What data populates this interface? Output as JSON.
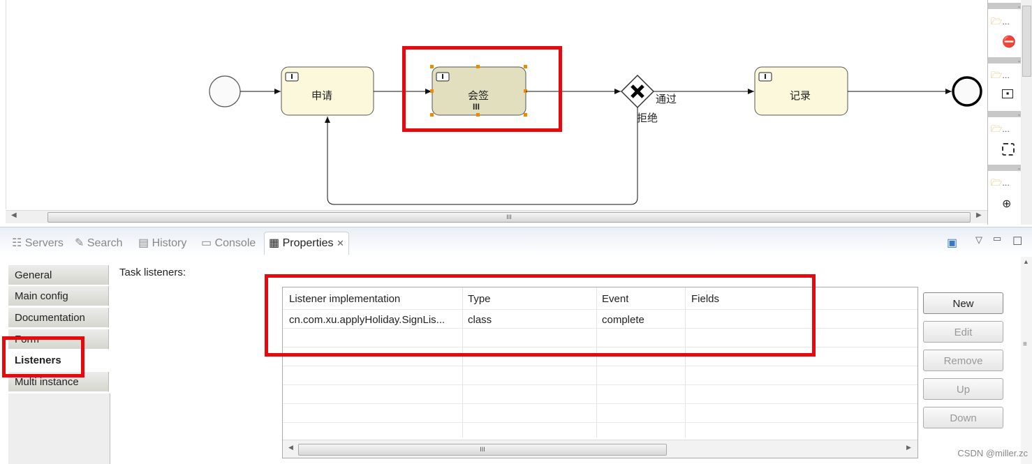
{
  "diagram": {
    "tasks": [
      {
        "label": "申请"
      },
      {
        "label": "会签"
      },
      {
        "label": "记录"
      }
    ],
    "gateway_labels": {
      "approve": "通过",
      "reject": "拒绝"
    },
    "scroll_grip": "III",
    "multi_instance_marker": "III"
  },
  "palette": {
    "items": [
      "…",
      "…",
      "…",
      "…"
    ]
  },
  "tabs": [
    {
      "label": "Servers"
    },
    {
      "label": "Search"
    },
    {
      "label": "History"
    },
    {
      "label": "Console"
    },
    {
      "label": "Properties",
      "active": true
    }
  ],
  "properties": {
    "side_tabs": [
      {
        "label": "General"
      },
      {
        "label": "Main config"
      },
      {
        "label": "Documentation"
      },
      {
        "label": "Form"
      },
      {
        "label": "Listeners",
        "selected": true
      },
      {
        "label": "Multi instance"
      }
    ],
    "section_label": "Task listeners:",
    "table": {
      "columns": [
        "Listener implementation",
        "Type",
        "Event",
        "Fields"
      ],
      "rows": [
        [
          "cn.com.xu.applyHoliday.SignLis...",
          "class",
          "complete",
          ""
        ]
      ],
      "scroll_grip": "III"
    },
    "buttons": [
      {
        "label": "New",
        "enabled": true
      },
      {
        "label": "Edit",
        "enabled": false
      },
      {
        "label": "Remove",
        "enabled": false
      },
      {
        "label": "Up",
        "enabled": false
      },
      {
        "label": "Down",
        "enabled": false
      }
    ]
  },
  "watermark": "CSDN @miller.zc",
  "colors": {
    "highlight": "#e8090f",
    "task_fill": "#fbf8dc",
    "selected_task_fill": "#e2dfbf"
  }
}
